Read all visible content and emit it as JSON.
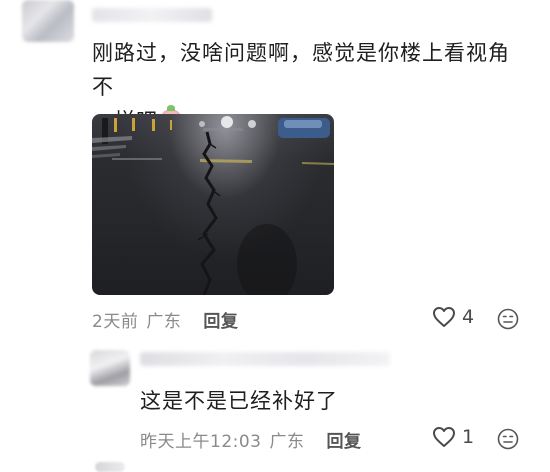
{
  "comments": [
    {
      "text_line1": "刚路过，没啥问题啊，感觉是你楼上看视角不",
      "text_line2": "一样吧",
      "emoji": "laughing-crying-emoji",
      "time": "2天前",
      "region": "广东",
      "reply_label": "回复",
      "likes": "4"
    },
    {
      "text": "这是不是已经补好了",
      "time": "昨天上午12:03",
      "region": "广东",
      "reply_label": "回复",
      "likes": "1"
    }
  ],
  "icons": {
    "like": "heart-outline-icon",
    "reaction": "face-emoji-icon"
  },
  "colors": {
    "text": "#1f1f1f",
    "meta": "#8a8a8a",
    "reply": "#555555",
    "background": "#ffffff"
  }
}
